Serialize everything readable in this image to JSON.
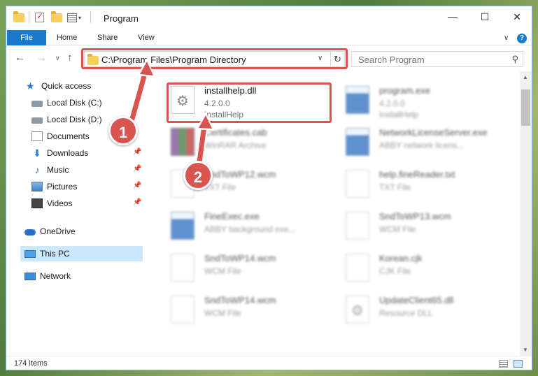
{
  "window": {
    "title": "Program",
    "controls": {
      "minimize": "—",
      "maximize": "☐",
      "close": "✕"
    }
  },
  "ribbon": {
    "tabs": [
      "File",
      "Home",
      "Share",
      "View"
    ],
    "expand_glyph": "∨",
    "help_glyph": "?"
  },
  "navigation": {
    "back": "←",
    "forward": "→",
    "recent": "∨",
    "up": "↑",
    "address": "C:\\Program Files\\Program Directory",
    "address_dropdown": "∨",
    "refresh": "↻",
    "search_placeholder": "Search Program",
    "search_glyph": "⚲"
  },
  "sidebar": {
    "items": [
      {
        "label": "Quick access",
        "icon": "star-icon"
      },
      {
        "label": "Local Disk (C:)",
        "icon": "drive-icon"
      },
      {
        "label": "Local Disk (D:)",
        "icon": "drive-icon"
      },
      {
        "label": "Documents",
        "icon": "documents-icon"
      },
      {
        "label": "Downloads",
        "icon": "downloads-icon",
        "pinned": true
      },
      {
        "label": "Music",
        "icon": "music-icon",
        "pinned": true
      },
      {
        "label": "Pictures",
        "icon": "pictures-icon",
        "pinned": true
      },
      {
        "label": "Videos",
        "icon": "videos-icon",
        "pinned": true
      },
      {
        "label": "OneDrive",
        "icon": "onedrive-icon"
      },
      {
        "label": "This PC",
        "icon": "pc-icon",
        "selected": true
      },
      {
        "label": "Network",
        "icon": "network-icon"
      }
    ],
    "pin_glyph": "📌"
  },
  "files": [
    {
      "name": "installhelp.dll",
      "line2": "4.2.0.0",
      "line3": "InstallHelp",
      "icon": "gear-icon",
      "highlighted": true
    },
    {
      "name": "program.exe",
      "line2": "4.2.0.0",
      "line3": "InstallHelp",
      "icon": "app-icon"
    },
    {
      "name": "Certificates.cab",
      "line2": "WinRAR Archive",
      "icon": "archive-icon"
    },
    {
      "name": "NetworkLicenseServer.exe",
      "line2": "ABBY network licens...",
      "icon": "app-icon"
    },
    {
      "name": "SndToWP12.wcm",
      "line2": "TXT File",
      "icon": "file-icon"
    },
    {
      "name": "help.fineReader.txt",
      "line2": "TXT File",
      "icon": "file-icon"
    },
    {
      "name": "FineExec.exe",
      "line2": "ABBY background exe...",
      "icon": "app-icon"
    },
    {
      "name": "SndToWP13.wcm",
      "line2": "WCM File",
      "icon": "file-icon"
    },
    {
      "name": "SndToWP14.wcm",
      "line2": "WCM File",
      "icon": "file-icon"
    },
    {
      "name": "Korean.cjk",
      "line2": "CJK File",
      "icon": "file-icon"
    },
    {
      "name": "SndToWP14.wcm",
      "line2": "WCM File",
      "icon": "file-icon"
    },
    {
      "name": "UpdateClient65.dll",
      "line2": "Resource DLL",
      "icon": "gear-icon"
    }
  ],
  "status": {
    "items_count": "174 items"
  },
  "callouts": {
    "step1": "1",
    "step2": "2"
  },
  "colors": {
    "accent": "#1979ca",
    "highlight": "#d9534f",
    "selected": "#cce8ff"
  }
}
